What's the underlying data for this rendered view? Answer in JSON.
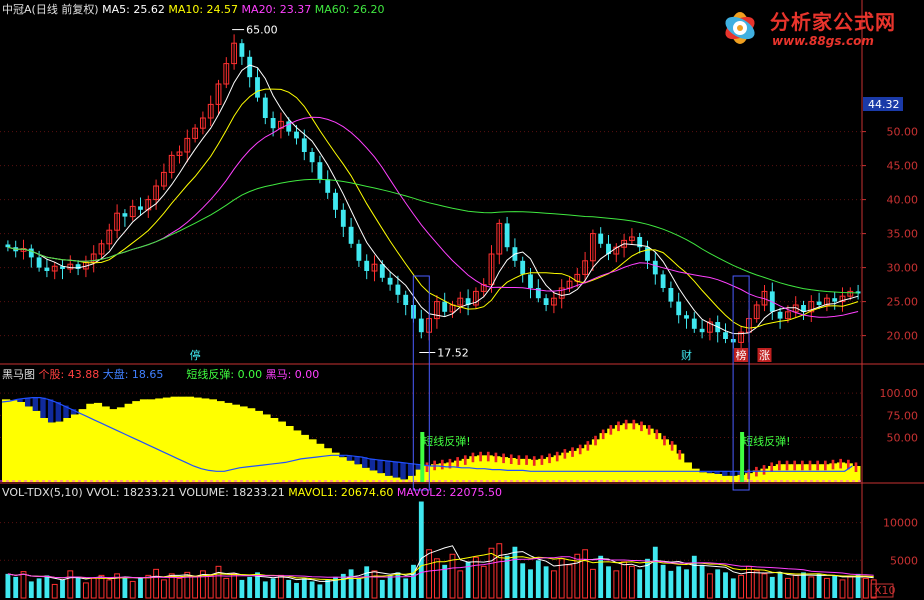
{
  "header": {
    "stock_title": "中冠A(日线 前复权)",
    "ma5": "MA5: 25.62",
    "ma10": "MA10: 24.57",
    "ma20": "MA20: 23.37",
    "ma60": "MA60: 26.20"
  },
  "price_panel": {
    "current_price_tag": "44.32",
    "high_label": "65.00",
    "low_label": "17.52",
    "marker_labels": [
      "停",
      "财",
      "榜",
      "涨"
    ]
  },
  "heima_panel": {
    "title": "黑马图",
    "stock_label": "个股: 43.88",
    "market_label": "大盘: 18.65",
    "rebound_label": "短线反弹: 0.00",
    "heima_label": "黑马: 0.00",
    "annotation_text": "短线反弹!"
  },
  "volume_panel": {
    "title": "VOL-TDX(5,10)",
    "vvol": "VVOL: 18233.21",
    "volume": "VOLUME: 18233.21",
    "mavol1": "MAVOL1: 20674.60",
    "mavol2": "MAVOL2: 22075.50",
    "unit_label": "X10"
  },
  "watermark": {
    "title": "分析家公式网",
    "url": "www.88gs.com"
  },
  "colors": {
    "up": "#ff3030",
    "down": "#40e8f0",
    "ma5": "#ffffff",
    "ma10": "#ffff00",
    "ma20": "#ff40ff",
    "ma60": "#40e840",
    "panel_yellow": "#ffff00",
    "panel_blue": "#102a9c",
    "panel_red": "#e82828",
    "axis": "#c83232"
  },
  "chart_data": [
    {
      "type": "candlestick",
      "title": "中冠A(日线 前复权)",
      "y_ticks": [
        20,
        25,
        30,
        35,
        40,
        45,
        50
      ],
      "ylim": [
        17,
        67
      ],
      "high": 65.0,
      "low": 17.52,
      "last_close": 26.2,
      "series": [
        {
          "name": "MA5",
          "last": 25.62
        },
        {
          "name": "MA10",
          "last": 24.57
        },
        {
          "name": "MA20",
          "last": 23.37
        },
        {
          "name": "MA60",
          "last": 26.2
        }
      ],
      "closes": [
        33,
        32.4,
        32.8,
        31.5,
        30.0,
        29.5,
        30.2,
        29.8,
        30.5,
        29.8,
        30.8,
        32.0,
        33.5,
        35.5,
        38,
        37.5,
        39,
        38.5,
        40,
        42,
        44,
        46.5,
        47,
        49,
        50.5,
        52,
        54,
        57,
        60,
        63,
        61,
        58,
        55,
        52,
        50.5,
        51.5,
        50,
        49,
        47,
        45.5,
        43,
        41,
        38.5,
        36,
        33.5,
        31,
        29.5,
        30.5,
        28.5,
        27.5,
        26,
        24.5,
        22.5,
        20.5,
        22.5,
        25,
        23.5,
        24.5,
        25.5,
        24.5,
        26.5,
        27.5,
        32,
        36.5,
        33,
        31,
        29,
        27,
        25.5,
        24.5,
        25.5,
        27,
        28,
        29,
        31,
        35,
        33.5,
        32,
        33,
        34,
        34.5,
        33,
        31,
        29,
        27,
        25,
        23,
        22.5,
        21,
        20.5,
        22,
        20.5,
        19.5,
        19,
        20.5,
        22.5,
        24.5,
        26.5,
        23.5,
        22.5,
        23.5,
        24.5,
        23.5,
        25,
        24.5,
        25.5,
        25,
        25.8,
        26.5,
        26.2
      ]
    },
    {
      "type": "area",
      "title": "黑马图",
      "y_ticks": [
        50,
        75,
        100
      ],
      "ylim": [
        0,
        117
      ],
      "series": [
        {
          "name": "个股",
          "last": 43.88
        },
        {
          "name": "大盘",
          "last": 18.65
        },
        {
          "name": "短线反弹",
          "last": 0.0
        },
        {
          "name": "黑马",
          "last": 0.0
        }
      ],
      "stock": [
        93,
        92,
        90,
        85,
        80,
        72,
        67,
        68,
        72,
        76,
        82,
        88,
        89,
        85,
        82,
        84,
        88,
        91,
        93,
        93,
        94,
        95,
        96,
        96,
        96,
        95,
        94,
        93,
        91,
        89,
        87,
        85,
        83,
        80,
        76,
        72,
        68,
        63,
        58,
        53,
        48,
        43,
        38,
        33,
        28,
        24,
        20,
        16,
        13,
        10,
        7,
        5,
        3,
        7,
        14,
        18,
        20,
        21,
        22,
        24,
        26,
        29,
        30,
        30,
        29,
        28,
        27,
        26,
        26,
        25,
        26,
        28,
        30,
        33,
        35,
        38,
        42,
        48,
        55,
        60,
        64,
        66,
        66,
        64,
        60,
        55,
        48,
        42,
        32,
        22,
        15,
        11,
        10,
        9,
        7,
        7,
        8,
        10,
        13,
        15,
        18,
        20,
        20,
        20,
        20,
        20,
        20,
        20,
        21,
        22,
        21,
        18
      ],
      "market": [
        90,
        91,
        93,
        94,
        95,
        95,
        93,
        90,
        86,
        82,
        78,
        74,
        70,
        66,
        62,
        58,
        54,
        50,
        46,
        42,
        38,
        34,
        30,
        26,
        22,
        18,
        15,
        13,
        12,
        12,
        14,
        16,
        17,
        18,
        19,
        20,
        21,
        22,
        24,
        26,
        27,
        28,
        29,
        30,
        30,
        30,
        29,
        28,
        26,
        25,
        24,
        23,
        22,
        21,
        20,
        19,
        18,
        18,
        17,
        17,
        16,
        16,
        15,
        15,
        14,
        14,
        13,
        13,
        13,
        12,
        12,
        12,
        12,
        12,
        12,
        12,
        12,
        12,
        12,
        12,
        12,
        12,
        12,
        12,
        12,
        12,
        12,
        12,
        12,
        12,
        12,
        12,
        12,
        12,
        12,
        12,
        12,
        12,
        12,
        12,
        12,
        12,
        12,
        12,
        12,
        12,
        12,
        12,
        12,
        12,
        12,
        18
      ]
    },
    {
      "type": "bar",
      "title": "VOL-TDX(5,10)",
      "y_ticks": [
        5000,
        10000
      ],
      "ylim": [
        0,
        13000
      ],
      "unit": "X10",
      "series": [
        {
          "name": "VVOL",
          "last": 18233.21
        },
        {
          "name": "VOLUME",
          "last": 18233.21
        },
        {
          "name": "MAVOL1",
          "last": 20674.6
        },
        {
          "name": "MAVOL2",
          "last": 22075.5
        }
      ],
      "volumes": [
        3200,
        2800,
        3500,
        2200,
        2600,
        3000,
        1800,
        2400,
        3600,
        2800,
        2000,
        2600,
        3000,
        2400,
        3200,
        2800,
        2200,
        2600,
        3000,
        3800,
        2400,
        3200,
        2600,
        3400,
        2800,
        3600,
        3000,
        4200,
        2600,
        3200,
        2400,
        2800,
        3400,
        2200,
        2600,
        3000,
        2400,
        2000,
        2600,
        2200,
        1800,
        2400,
        2800,
        3200,
        3800,
        2600,
        4200,
        3600,
        2400,
        3000,
        3400,
        2600,
        4400,
        12800,
        6400,
        5200,
        4400,
        5800,
        3600,
        4800,
        5400,
        4200,
        6600,
        7200,
        5600,
        6800,
        4600,
        3800,
        5000,
        4200,
        3600,
        5200,
        4400,
        5800,
        6400,
        3800,
        5600,
        4200,
        3600,
        4800,
        4200,
        3800,
        5200,
        6800,
        4400,
        3600,
        4200,
        3800,
        5600,
        4400,
        3200,
        3800,
        3400,
        2600,
        3000,
        4200,
        3600,
        3200,
        2800,
        3400,
        2600,
        3000,
        3400,
        2800,
        3200,
        2600,
        3000,
        2400,
        2800,
        3200,
        2600,
        2400
      ]
    }
  ]
}
